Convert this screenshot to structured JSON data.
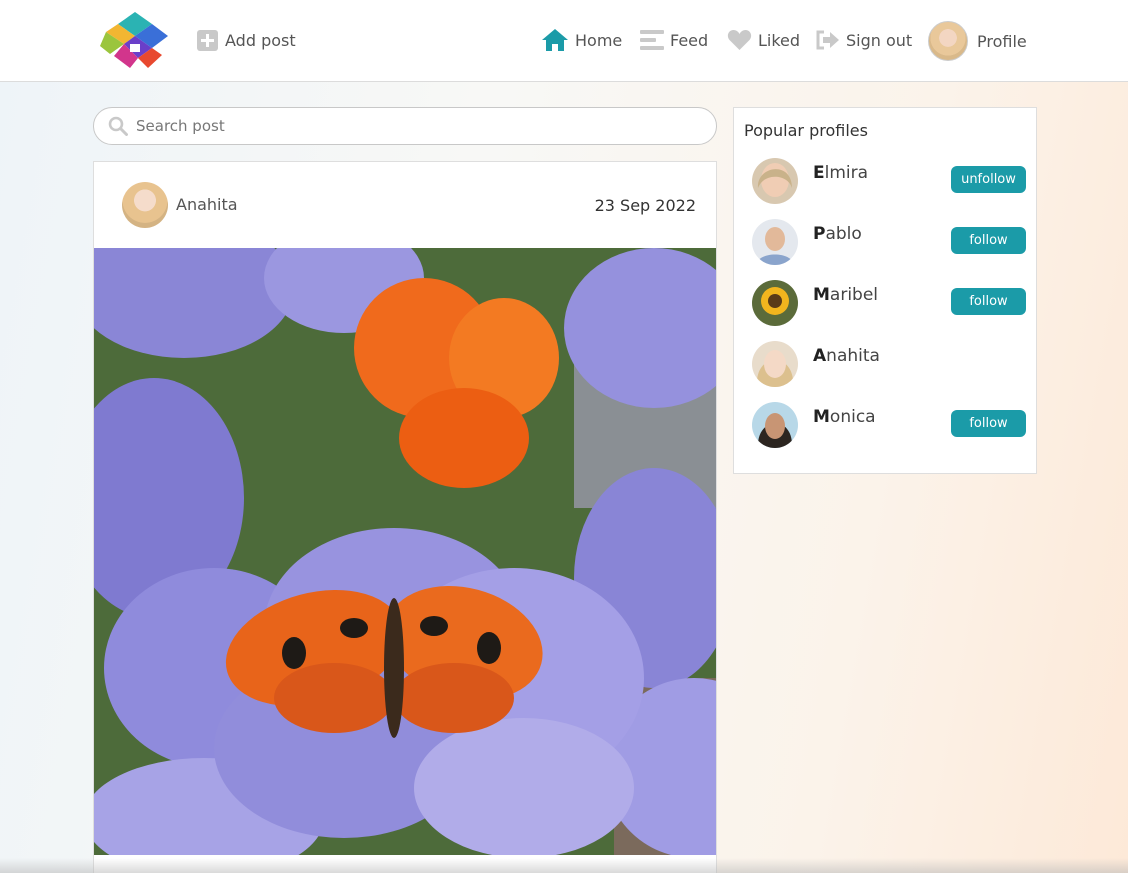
{
  "header": {
    "add_post_label": "Add post",
    "nav": {
      "home": "Home",
      "feed": "Feed",
      "liked": "Liked",
      "sign_out": "Sign out",
      "profile": "Profile"
    }
  },
  "search": {
    "placeholder": "Search post"
  },
  "post": {
    "author": "Anahita",
    "date": "23 Sep 2022"
  },
  "sidebar": {
    "title": "Popular profiles",
    "profiles": [
      {
        "initial": "E",
        "rest": "lmira",
        "button": "unfollow"
      },
      {
        "initial": "P",
        "rest": "ablo",
        "button": "follow"
      },
      {
        "initial": "M",
        "rest": "aribel",
        "button": "follow"
      },
      {
        "initial": "A",
        "rest": "nahita",
        "button": ""
      },
      {
        "initial": "M",
        "rest": "onica",
        "button": "follow"
      }
    ]
  },
  "colors": {
    "accent": "#1b9ba8",
    "home_icon": "#1b9ba8",
    "icon_gray": "#c9c9c9"
  }
}
